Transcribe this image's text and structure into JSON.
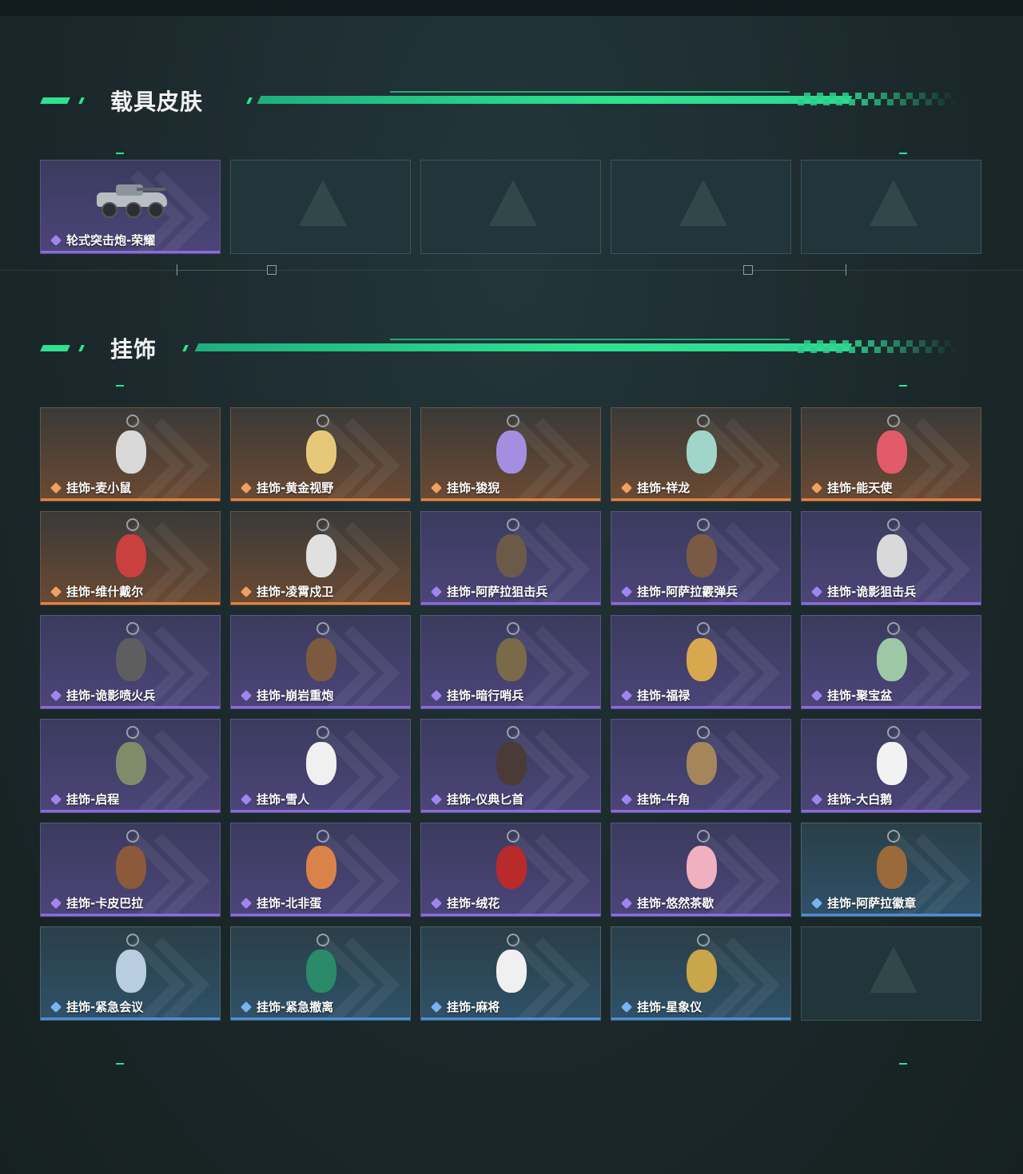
{
  "sections": [
    {
      "title": "载具皮肤",
      "items": [
        {
          "name": "轮式突击炮-荣耀",
          "rarity": "purple",
          "icon": "armored-vehicle"
        },
        {
          "name": "",
          "rarity": "empty"
        },
        {
          "name": "",
          "rarity": "empty"
        },
        {
          "name": "",
          "rarity": "empty"
        },
        {
          "name": "",
          "rarity": "empty"
        }
      ]
    },
    {
      "title": "挂饰",
      "items": [
        {
          "name": "挂饰-麦小鼠",
          "rarity": "orange",
          "color": "#d8d8d8"
        },
        {
          "name": "挂饰-黄金视野",
          "rarity": "orange",
          "color": "#e7c879"
        },
        {
          "name": "挂饰-狻猊",
          "rarity": "orange",
          "color": "#a58ee0"
        },
        {
          "name": "挂饰-祥龙",
          "rarity": "orange",
          "color": "#9fd6c9"
        },
        {
          "name": "挂饰-能天使",
          "rarity": "orange",
          "color": "#e25b6b"
        },
        {
          "name": "挂饰-维什戴尔",
          "rarity": "orange",
          "color": "#c9403f"
        },
        {
          "name": "挂饰-凌霄戍卫",
          "rarity": "orange",
          "color": "#e0e0e0"
        },
        {
          "name": "挂饰-阿萨拉狙击兵",
          "rarity": "purple",
          "color": "#6b5a48"
        },
        {
          "name": "挂饰-阿萨拉霰弹兵",
          "rarity": "purple",
          "color": "#7a5a45"
        },
        {
          "name": "挂饰-诡影狙击兵",
          "rarity": "purple",
          "color": "#d9d9d9"
        },
        {
          "name": "挂饰-诡影喷火兵",
          "rarity": "purple",
          "color": "#5e5e5e"
        },
        {
          "name": "挂饰-崩岩重炮",
          "rarity": "purple",
          "color": "#7c5a3f"
        },
        {
          "name": "挂饰-暗行哨兵",
          "rarity": "purple",
          "color": "#7a6a4a"
        },
        {
          "name": "挂饰-福禄",
          "rarity": "purple",
          "color": "#d8a84e"
        },
        {
          "name": "挂饰-聚宝盆",
          "rarity": "purple",
          "color": "#9ec8a5"
        },
        {
          "name": "挂饰-启程",
          "rarity": "purple",
          "color": "#7f8c6a"
        },
        {
          "name": "挂饰-雪人",
          "rarity": "purple",
          "color": "#f0f0f0"
        },
        {
          "name": "挂饰-仪典匕首",
          "rarity": "purple",
          "color": "#4a3b36"
        },
        {
          "name": "挂饰-牛角",
          "rarity": "purple",
          "color": "#a5865a"
        },
        {
          "name": "挂饰-大白鹅",
          "rarity": "purple",
          "color": "#f2f2f2"
        },
        {
          "name": "挂饰-卡皮巴拉",
          "rarity": "purple",
          "color": "#8a5a3a"
        },
        {
          "name": "挂饰-北非蛋",
          "rarity": "purple",
          "color": "#d9834a"
        },
        {
          "name": "挂饰-绒花",
          "rarity": "purple",
          "color": "#b92a2a"
        },
        {
          "name": "挂饰-悠然茶歇",
          "rarity": "purple",
          "color": "#f0b0c0"
        },
        {
          "name": "挂饰-阿萨拉徽章",
          "rarity": "blue",
          "color": "#9a6a3a"
        },
        {
          "name": "挂饰-紧急会议",
          "rarity": "blue",
          "color": "#b9cde0"
        },
        {
          "name": "挂饰-紧急撤离",
          "rarity": "blue",
          "color": "#2a8a6a"
        },
        {
          "name": "挂饰-麻将",
          "rarity": "blue",
          "color": "#f0f0f0"
        },
        {
          "name": "挂饰-星象仪",
          "rarity": "blue",
          "color": "#c9a64a"
        },
        {
          "name": "",
          "rarity": "empty"
        }
      ]
    }
  ]
}
